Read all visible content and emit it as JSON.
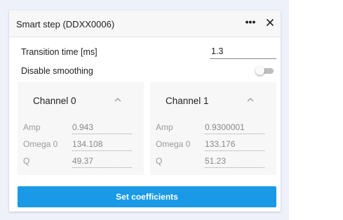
{
  "dialog": {
    "title": "Smart step (DDXX0006)",
    "more_glyph": "•••"
  },
  "transition": {
    "label": "Transition time [ms]",
    "value": "1.3"
  },
  "smoothing": {
    "label": "Disable smoothing",
    "enabled": false
  },
  "channels": [
    {
      "title": "Channel 0",
      "params": [
        {
          "label": "Amp",
          "value": "0.943"
        },
        {
          "label": "Omega 0",
          "value": "134.108"
        },
        {
          "label": "Q",
          "value": "49.37"
        }
      ]
    },
    {
      "title": "Channel 1",
      "params": [
        {
          "label": "Amp",
          "value": "0.9300001"
        },
        {
          "label": "Omega 0",
          "value": "133.176"
        },
        {
          "label": "Q",
          "value": "51.23"
        }
      ]
    }
  ],
  "actions": {
    "set_coefficients_label": "Set coefficients"
  },
  "colors": {
    "accent": "#1a9ae6",
    "background": "#eef1f9",
    "card": "#f7f7f8"
  },
  "icons": [
    "more-icon",
    "close-icon",
    "chevron-up-icon",
    "toggle-switch"
  ]
}
